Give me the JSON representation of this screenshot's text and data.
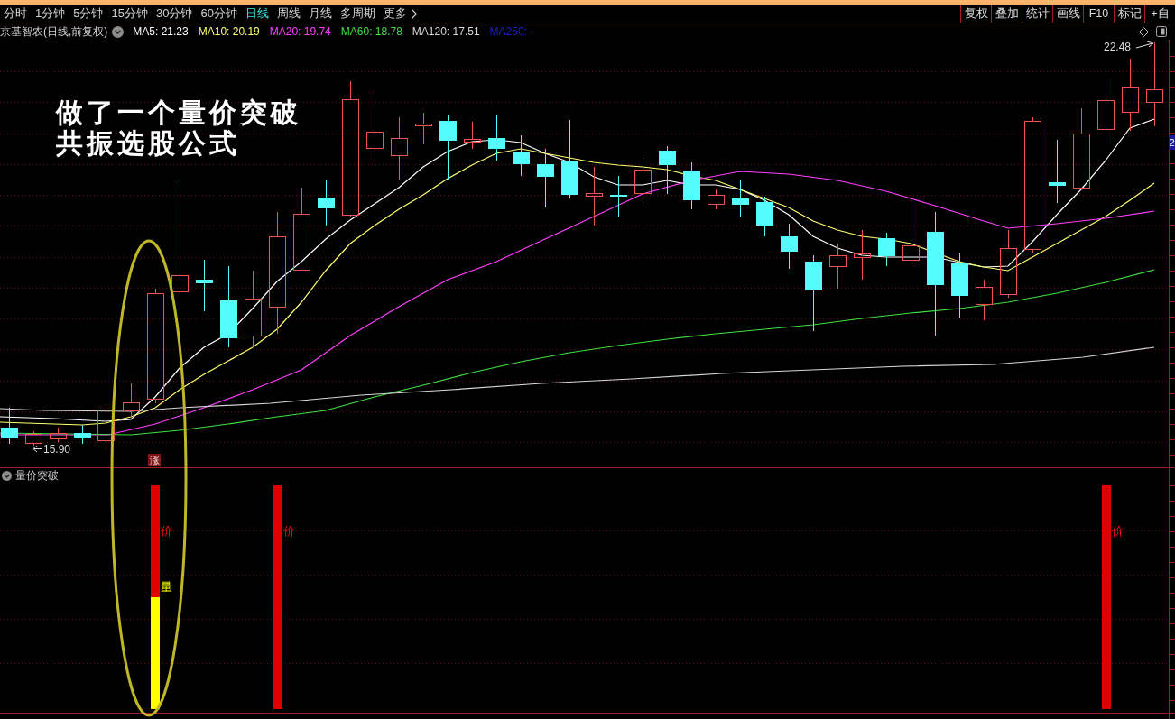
{
  "toolbar": {
    "periods": [
      {
        "label": "分时",
        "selected": false
      },
      {
        "label": "1分钟",
        "selected": false
      },
      {
        "label": "5分钟",
        "selected": false
      },
      {
        "label": "15分钟",
        "selected": false
      },
      {
        "label": "30分钟",
        "selected": false
      },
      {
        "label": "60分钟",
        "selected": false
      },
      {
        "label": "日线",
        "selected": true
      },
      {
        "label": "周线",
        "selected": false
      },
      {
        "label": "月线",
        "selected": false
      },
      {
        "label": "多周期",
        "selected": false
      }
    ],
    "more": {
      "label": "更多"
    },
    "actions": [
      "复权",
      "叠加",
      "统计",
      "画线",
      "F10",
      "标记",
      "+自"
    ]
  },
  "chart_header": {
    "title": "京基智农(日线,前复权)",
    "indicators": [
      {
        "label": "MA5: 21.23",
        "color": "#ffffff"
      },
      {
        "label": "MA10: 20.19",
        "color": "#ffff70"
      },
      {
        "label": "MA20: 19.74",
        "color": "#ff40ff"
      },
      {
        "label": "MA60: 18.78",
        "color": "#40e040"
      },
      {
        "label": "MA120: 17.51",
        "color": "#d8d8d8"
      },
      {
        "label": "MA250: -",
        "color": "#2020c8"
      }
    ]
  },
  "annotation": {
    "lines": [
      "做了一个量价突破",
      "共振选股公式"
    ]
  },
  "price_chart": {
    "high_label": "22.48",
    "low_label": "15.90",
    "signal_tag": "涨",
    "axis_tag": "2"
  },
  "indicator_panel": {
    "title": "量价突破",
    "signals": [
      {
        "price_label": "价",
        "volume_label": "量"
      },
      {
        "price_label": "价"
      },
      {
        "price_label": "价"
      }
    ]
  }
}
